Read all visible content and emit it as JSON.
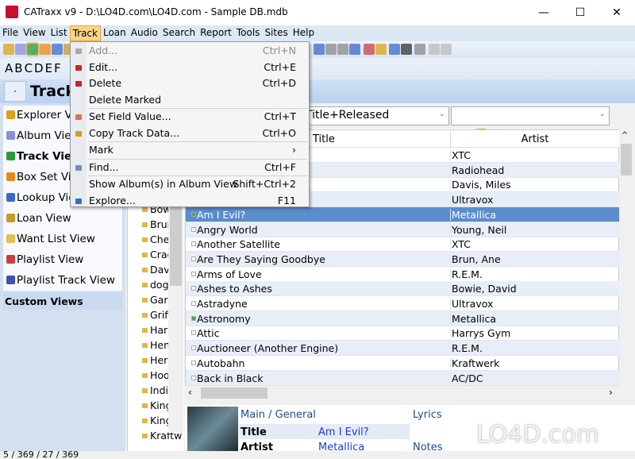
{
  "window": {
    "title": "CATraxx v9 - D:\\LO4D.com\\LO4D.com - Sample DB.mdb",
    "controls": [
      "—",
      "☐",
      "✕"
    ]
  },
  "menubar": [
    "File",
    "View",
    "List",
    "Track",
    "Loan",
    "Audio",
    "Search",
    "Report",
    "Tools",
    "Sites",
    "Help"
  ],
  "letters": [
    "A",
    "B",
    "C",
    "D",
    "E",
    "F"
  ],
  "view_header": {
    "collapse": "·",
    "title": "Track"
  },
  "sidebar": {
    "items": [
      {
        "label": "Explorer View",
        "icon": "explorer-icon",
        "color": "#d9a21b"
      },
      {
        "label": "Album View",
        "icon": "disc-icon",
        "color": "#8a8fd8"
      },
      {
        "label": "Track View",
        "icon": "note-icon",
        "color": "#2a9a3a",
        "bold": true
      },
      {
        "label": "Box Set View",
        "icon": "boxset-icon",
        "color": "#e88a1a"
      },
      {
        "label": "Lookup View",
        "icon": "lookup-icon",
        "color": "#3a6ac8"
      },
      {
        "label": "Loan View",
        "icon": "loan-icon",
        "color": "#c89a2a"
      },
      {
        "label": "Want List View",
        "icon": "wantlist-icon",
        "color": "#e0c050"
      },
      {
        "label": "Playlist View",
        "icon": "playlist-icon",
        "color": "#c84040"
      },
      {
        "label": "Playlist Track View",
        "icon": "playlist-track-icon",
        "color": "#4050b8"
      }
    ],
    "custom_views": "Custom Views"
  },
  "tree": [
    "Bowie",
    "Brun,",
    "Chesn",
    "Cracke",
    "Davis,",
    "dog's",
    "Garba",
    "Griffit",
    "Harrys",
    "Henry",
    "Hersh",
    "Hooti",
    "Indigo",
    "King C",
    "King's",
    "Kraftw"
  ],
  "filter": {
    "sort": "Title+Released",
    "second": ""
  },
  "grid": {
    "columns": [
      "Title",
      "Artist"
    ],
    "rows": [
      {
        "title": "",
        "artist": "XTC"
      },
      {
        "title": "",
        "artist": "Radiohead"
      },
      {
        "title": "",
        "artist": "Davis, Miles"
      },
      {
        "title": "",
        "artist": "Ultravox"
      },
      {
        "title": "Am I Evil?",
        "artist": "Metallica",
        "selected": true,
        "checked": true
      },
      {
        "title": "Angry World",
        "artist": "Young, Neil"
      },
      {
        "title": "Another Satellite",
        "artist": "XTC"
      },
      {
        "title": "Are They Saying Goodbye",
        "artist": "Brun, Ane"
      },
      {
        "title": "Arms of Love",
        "artist": "R.E.M."
      },
      {
        "title": "Ashes to Ashes",
        "artist": "Bowie, David"
      },
      {
        "title": "Astradyne",
        "artist": "Ultravox"
      },
      {
        "title": "Astronomy",
        "artist": "Metallica",
        "checked": true
      },
      {
        "title": "Attic",
        "artist": "Harrys Gym"
      },
      {
        "title": "Auctioneer (Another Engine)",
        "artist": "R.E.M."
      },
      {
        "title": "Autobahn",
        "artist": "Kraftwerk"
      },
      {
        "title": "Back in Black",
        "artist": "AC/DC"
      }
    ]
  },
  "detail": {
    "section": "Main / General",
    "lyrics": "Lyrics",
    "notes": "Notes",
    "fields": [
      {
        "label": "Title",
        "value": "Am I Evil?"
      },
      {
        "label": "Artist",
        "value": "Metallica"
      }
    ]
  },
  "status": "5 / 369 / 27 / 369",
  "track_menu": [
    {
      "label": "Add...",
      "shortcut": "Ctrl+N",
      "disabled": true,
      "icon": "add-icon",
      "color": "#aaaaaa"
    },
    {
      "label": "Edit...",
      "shortcut": "Ctrl+E",
      "icon": "edit-icon",
      "color": "#d02020"
    },
    {
      "label": "Delete",
      "shortcut": "Ctrl+D",
      "icon": "delete-icon",
      "color": "#d02020"
    },
    {
      "label": "Delete Marked",
      "shortcut": ""
    },
    {
      "label": "Set Field Value...",
      "shortcut": "Ctrl+T",
      "icon": "set-field-icon",
      "color": "#e07050",
      "sep": true
    },
    {
      "label": "Copy Track Data...",
      "shortcut": "Ctrl+O",
      "icon": "copy-icon",
      "color": "#d0a020"
    },
    {
      "label": "Mark",
      "shortcut": "›",
      "sep": true
    },
    {
      "label": "Find...",
      "shortcut": "Ctrl+F",
      "icon": "find-icon",
      "color": "#7090c0",
      "sep": true
    },
    {
      "label": "Show Album(s) in Album View",
      "shortcut": "Shift+Ctrl+2",
      "sep": true
    },
    {
      "label": "Explore...",
      "shortcut": "F11",
      "icon": "explore-icon",
      "color": "#3070c0"
    }
  ],
  "watermark": "LO4D.com"
}
